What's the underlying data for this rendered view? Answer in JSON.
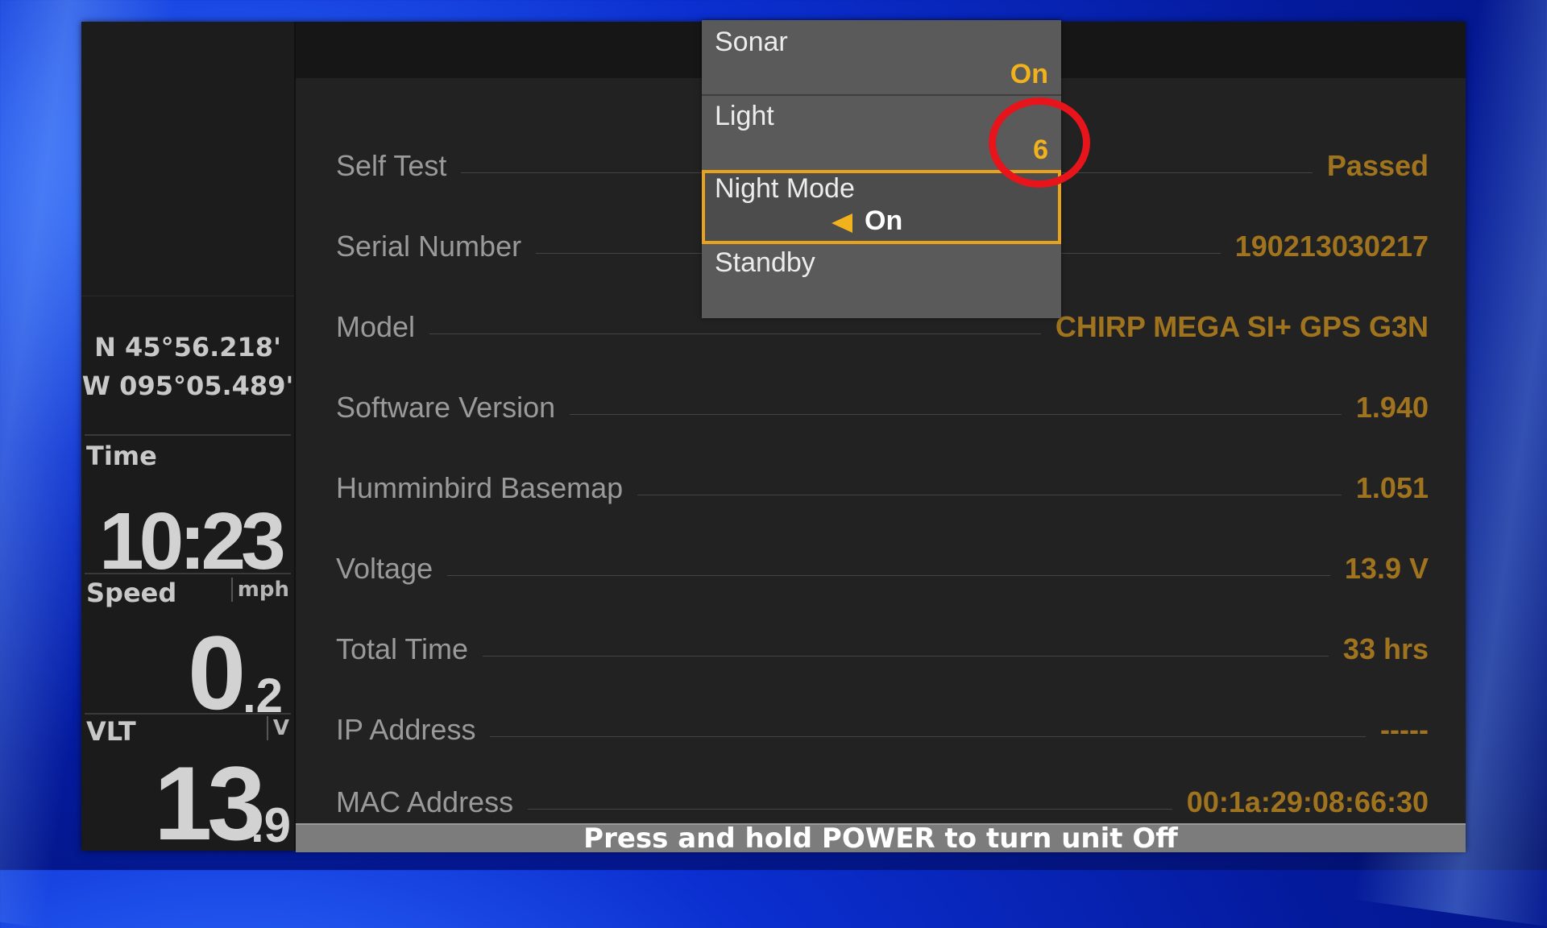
{
  "sidebar": {
    "latitude": "N 45°56.218'",
    "longitude": "W 095°05.489'",
    "time_label": "Time",
    "time_value": "10:23",
    "speed_label": "Speed",
    "speed_unit": "mph",
    "speed_int": "0",
    "speed_dec": ".2",
    "vlt_label": "VLT",
    "vlt_unit": "V",
    "vlt_int": "13",
    "vlt_dec": ".9"
  },
  "info_rows": [
    {
      "label": "Self Test",
      "value": "Passed"
    },
    {
      "label": "Serial Number",
      "value": "190213030217"
    },
    {
      "label": "Model",
      "value": "CHIRP MEGA SI+ GPS G3N"
    },
    {
      "label": "Software Version",
      "value": "1.940"
    },
    {
      "label": "Humminbird Basemap",
      "value": "1.051"
    },
    {
      "label": "Voltage",
      "value": "13.9 V"
    },
    {
      "label": "Total Time",
      "value": "33 hrs"
    },
    {
      "label": "IP Address",
      "value": "-----"
    },
    {
      "label": "MAC Address",
      "value": "00:1a:29:08:66:30"
    }
  ],
  "menu": {
    "items": [
      {
        "title": "Sonar",
        "value": "On"
      },
      {
        "title": "Light",
        "value": "6"
      },
      {
        "title": "Night Mode",
        "value": "On"
      },
      {
        "title": "Standby",
        "value": ""
      }
    ],
    "selected_index": 2
  },
  "status_bar": "Press and hold POWER to turn unit Off",
  "colors": {
    "accent": "#f2b21c",
    "value_text": "#a0741e",
    "annotation": "#e8141b",
    "background_blue": "#0b2fd0"
  }
}
